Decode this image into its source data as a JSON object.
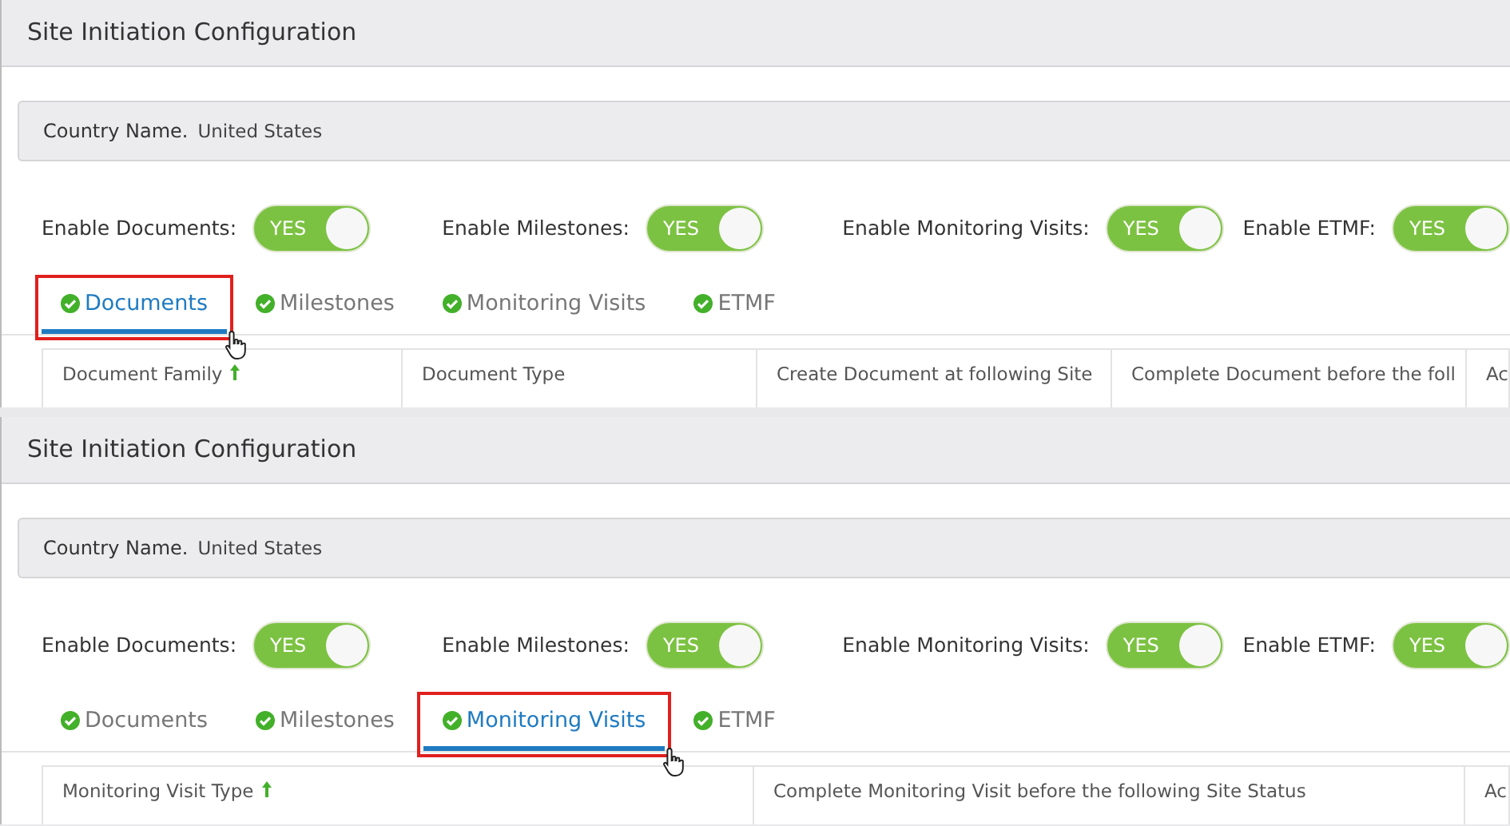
{
  "panels": [
    {
      "title": "Site Initiation Configuration",
      "country": {
        "label": "Country Name.",
        "value": "United States"
      },
      "toggles": [
        {
          "label": "Enable Documents:",
          "text": "YES",
          "on": true
        },
        {
          "label": "Enable Milestones:",
          "text": "YES",
          "on": true
        },
        {
          "label": "Enable Monitoring Visits:",
          "text": "YES",
          "on": true
        },
        {
          "label": "Enable ETMF:",
          "text": "YES",
          "on": true
        }
      ],
      "tabs": [
        {
          "label": "Documents",
          "selected": true
        },
        {
          "label": "Milestones",
          "selected": false
        },
        {
          "label": "Monitoring Visits",
          "selected": false
        },
        {
          "label": "ETMF",
          "selected": false
        }
      ],
      "columns": [
        {
          "label": "Document Family",
          "sorted": true
        },
        {
          "label": "Document Type",
          "sorted": false
        },
        {
          "label": "Create Document at following Site",
          "sorted": false
        },
        {
          "label": "Complete Document before the foll",
          "sorted": false
        },
        {
          "label": "Ac",
          "sorted": false
        }
      ]
    },
    {
      "title": "Site Initiation Configuration",
      "country": {
        "label": "Country Name.",
        "value": "United States"
      },
      "toggles": [
        {
          "label": "Enable Documents:",
          "text": "YES",
          "on": true
        },
        {
          "label": "Enable Milestones:",
          "text": "YES",
          "on": true
        },
        {
          "label": "Enable Monitoring Visits:",
          "text": "YES",
          "on": true
        },
        {
          "label": "Enable ETMF:",
          "text": "YES",
          "on": true
        }
      ],
      "tabs": [
        {
          "label": "Documents",
          "selected": false
        },
        {
          "label": "Milestones",
          "selected": false
        },
        {
          "label": "Monitoring Visits",
          "selected": true
        },
        {
          "label": "ETMF",
          "selected": false
        }
      ],
      "columns": [
        {
          "label": "Monitoring Visit Type",
          "sorted": true
        },
        {
          "label": "Complete Monitoring Visit before the following Site Status",
          "sorted": false
        },
        {
          "label": "Ac",
          "sorted": false
        }
      ]
    }
  ]
}
